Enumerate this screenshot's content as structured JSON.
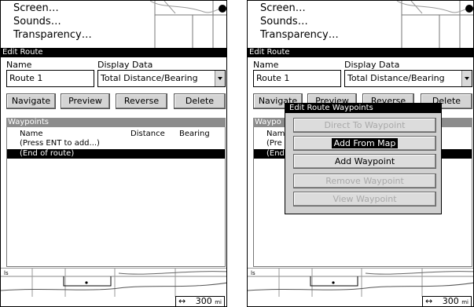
{
  "menu": [
    "Screen…",
    "Sounds…",
    "Transparency…"
  ],
  "edit_route": {
    "title": "Edit Route",
    "name_label": "Name",
    "name_value": "Route 1",
    "display_label": "Display Data",
    "display_value": "Total Distance/Bearing",
    "buttons": {
      "navigate": "Navigate",
      "preview": "Preview",
      "reverse": "Reverse",
      "delete": "Delete"
    }
  },
  "waypoints": {
    "title": "Waypoints",
    "columns": {
      "name": "Name",
      "distance": "Distance",
      "bearing": "Bearing"
    },
    "rows": [
      "(Press ENT to add...)",
      "(End of route)"
    ],
    "selected_row": 1
  },
  "right_panel_truncated": {
    "preview": "Preview",
    "reverse": "Reverse",
    "delete": "Delete",
    "section": "Waypo",
    "col_name": "Nam",
    "row1": "(Pre",
    "row2": "(End"
  },
  "popup": {
    "title": "Edit Route Waypoints",
    "items": [
      {
        "label": "Direct To Waypoint",
        "enabled": false
      },
      {
        "label": "Add From Map",
        "enabled": true,
        "selected": true
      },
      {
        "label": "Add Waypoint",
        "enabled": true
      },
      {
        "label": "Remove Waypoint",
        "enabled": false
      },
      {
        "label": "View Waypoint",
        "enabled": false
      }
    ]
  },
  "scale": {
    "value": "300",
    "unit": "mi"
  }
}
